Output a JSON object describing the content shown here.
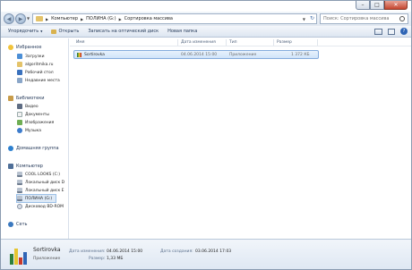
{
  "address": {
    "crumbs": [
      "Компьютер",
      "ПОЛИНА (G:)",
      "Сортировка массива"
    ],
    "search_placeholder": "Поиск: Сортировка массива"
  },
  "toolbar": {
    "organize": "Упорядочить",
    "open": "Открыть",
    "burn": "Записать на оптический диск",
    "new_folder": "Новая папка"
  },
  "nav": {
    "favorites": "Избранное",
    "downloads": "Загрузки",
    "algorithmics": "algoritmika.ru",
    "desktop": "Рабочий стол",
    "recent": "Недавние места",
    "libraries": "Библиотеки",
    "video": "Видео",
    "documents": "Документы",
    "images": "Изображения",
    "music": "Музыка",
    "homegroup": "Домашняя группа",
    "computer": "Компьютер",
    "drive_c": "COOL LOOKS (C:)",
    "drive_d": "Локальный диск D",
    "drive_e": "Локальный диск E",
    "drive_g": "ПОЛИНА (G:)",
    "cdrom": "Дисковод BD-ROM",
    "network": "Сеть"
  },
  "columns": {
    "name": "Имя",
    "modified": "Дата изменения",
    "type": "Тип",
    "size": "Размер"
  },
  "files": [
    {
      "name": "Sortirovka",
      "modified": "04.06.2014 15:00",
      "type": "Приложение",
      "size": "1 372 КБ"
    }
  ],
  "details": {
    "name": "Sortirovka",
    "type": "Приложение",
    "modified_label": "Дата изменения:",
    "modified": "04.06.2014 15:00",
    "created_label": "Дата создания:",
    "created": "03.06.2014 17:03",
    "size_label": "Размер:",
    "size": "1,33 МБ"
  },
  "colors": {
    "selection": "#cfe3f9",
    "toolbar_text": "#1e3354",
    "close_button": "#c4452f"
  }
}
